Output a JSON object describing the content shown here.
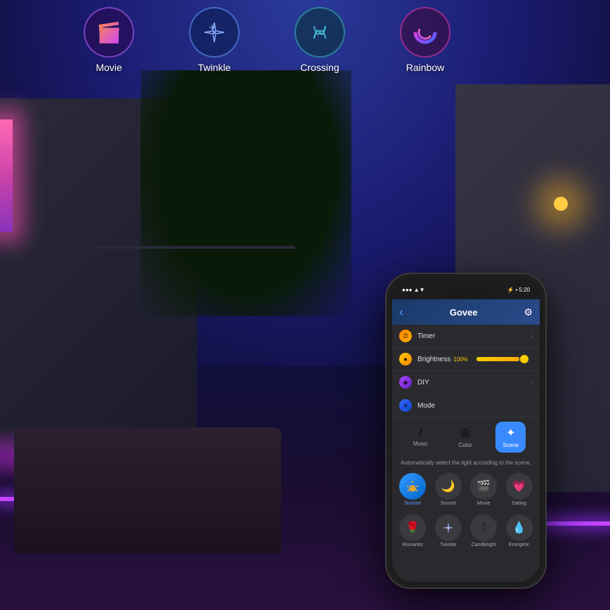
{
  "background": {
    "sky_color_top": "#1a2a8a",
    "sky_color_bottom": "#0a0820"
  },
  "top_icons": [
    {
      "id": "movie",
      "label": "Movie",
      "emoji": "🎬",
      "color_class": "icon-movie"
    },
    {
      "id": "twinkle",
      "label": "Twinkle",
      "emoji": "✦",
      "color_class": "icon-twinkle"
    },
    {
      "id": "crossing",
      "label": "Crossing",
      "emoji": "∫",
      "color_class": "icon-crossing"
    },
    {
      "id": "rainbow",
      "label": "Rainbow",
      "emoji": "◎",
      "color_class": "icon-rainbow"
    }
  ],
  "phone": {
    "status_bar": {
      "time": "5:20",
      "signal": "●●●",
      "battery": "🔋"
    },
    "nav": {
      "title": "Govee",
      "back_icon": "‹",
      "settings_icon": "⚙"
    },
    "menu_items": [
      {
        "id": "timer",
        "icon": "🟠",
        "label": "Timer",
        "has_chevron": true
      },
      {
        "id": "brightness",
        "icon": "🟡",
        "label": "Brightness",
        "value": "100%",
        "has_slider": true
      },
      {
        "id": "diy",
        "icon": "🟣",
        "label": "DIY",
        "has_chevron": true
      },
      {
        "id": "mode",
        "icon": "🔵",
        "label": "Mode",
        "has_chevron": false
      }
    ],
    "mode_tabs": [
      {
        "id": "music",
        "label": "Music",
        "emoji": "♪",
        "active": false
      },
      {
        "id": "color",
        "label": "Color",
        "emoji": "◎",
        "active": false
      },
      {
        "id": "scene",
        "label": "Scene",
        "emoji": "✦",
        "active": true
      }
    ],
    "scene_subtitle": "Automatically select the light according to the scene.",
    "scenes_row1": [
      {
        "id": "sunrise",
        "label": "Sunrise",
        "emoji": "🌅",
        "active": true
      },
      {
        "id": "sunset",
        "label": "Sunset",
        "emoji": "🌙"
      },
      {
        "id": "movie",
        "label": "Movie",
        "emoji": "🎬"
      },
      {
        "id": "dating",
        "label": "Dating",
        "emoji": "💗"
      }
    ],
    "scenes_row2": [
      {
        "id": "romantic",
        "label": "Romantic",
        "emoji": "🌹"
      },
      {
        "id": "twinkle",
        "label": "Twinkle",
        "emoji": "✦"
      },
      {
        "id": "candlelight",
        "label": "Candlelight",
        "emoji": "🕯"
      },
      {
        "id": "energetic",
        "label": "Energetic",
        "emoji": "💧"
      }
    ]
  }
}
